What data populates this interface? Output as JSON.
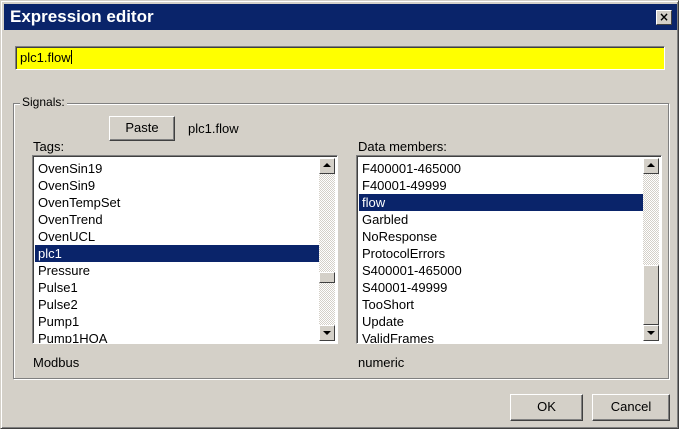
{
  "window": {
    "title": "Expression editor",
    "close_glyph": "×"
  },
  "expression": {
    "value": "plc1.flow"
  },
  "signals": {
    "legend": "Signals:",
    "paste_label": "Paste",
    "selected_signal": "plc1.flow",
    "tags_label": "Tags:",
    "members_label": "Data members:",
    "tags": {
      "items": [
        "OvenSin19",
        "OvenSin9",
        "OvenTempSet",
        "OvenTrend",
        "OvenUCL",
        "plc1",
        "Pressure",
        "Pulse1",
        "Pulse2",
        "Pump1",
        "Pump1HOA"
      ],
      "selected": "plc1",
      "scroll_position": 0.7
    },
    "members": {
      "items": [
        "F400001-465000",
        "F40001-49999",
        "flow",
        "Garbled",
        "NoResponse",
        "ProtocolErrors",
        "S400001-465000",
        "S40001-49999",
        "TooShort",
        "Update",
        "ValidFrames"
      ],
      "selected": "flow",
      "scroll_position": 1.0
    },
    "tag_type": "Modbus",
    "member_type": "numeric"
  },
  "buttons": {
    "ok_label": "OK",
    "cancel_label": "Cancel"
  },
  "colors": {
    "title_bar": "#0a246a",
    "selection": "#0a246a",
    "expression_bg": "#ffff00",
    "face": "#d4d0c8"
  }
}
